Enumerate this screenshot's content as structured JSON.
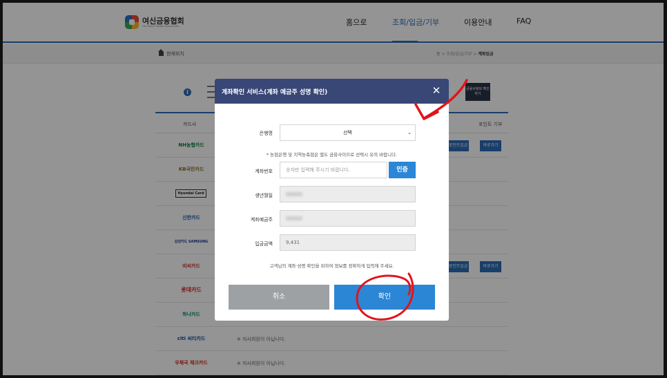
{
  "header": {
    "logo_title": "여신금융협회",
    "logo_sub": "THE CREDIT FINANCE ASSOCIATION",
    "nav": [
      "홈으로",
      "조회/입금/기부",
      "이용안내",
      "FAQ"
    ],
    "active_nav": "조회/입금/기부"
  },
  "breadcrumb": {
    "here": "현재위치",
    "trail": [
      "홈",
      "조회/입금/기부"
    ],
    "current": "계좌입금"
  },
  "background": {
    "dark_button": "금융사정보 확인하기",
    "table_headers": [
      "카드사",
      "포인트 기부"
    ],
    "cards": [
      "NH농협카드",
      "KB국민카드",
      "Hyundai Card",
      "신한카드",
      "삼성카드 SAMSUNG",
      "비씨카드",
      "롯데카드",
      "하나카드",
      "citi 씨티카드",
      "우체국 체크카드"
    ],
    "row_buttons": [
      "포인트입금",
      "바로가기"
    ],
    "non_member_note": "※ 자사회원이 아닙니다."
  },
  "modal": {
    "title": "계좌확인 서비스(계좌 예금주 성명 확인)",
    "bank_label": "은행명",
    "bank_value": "선택",
    "bank_note": "* 농협은행 및 지역농축협은 별도 금융사이므로 선택시 유의 바랍니다.",
    "account_label": "계좌번호",
    "account_placeholder": "숫자만 입력해 주시기 바랍니다.",
    "auth_button": "인증",
    "birth_label": "생년월일",
    "holder_label": "계좌예금주",
    "amount_label": "입금금액",
    "amount_value": "9,431",
    "footer_note": "고객님의 계좌·성명 확인을 위하여 정보를 정확하게 입력해 주세요.",
    "cancel_button": "취소",
    "confirm_button": "확인"
  },
  "colors": {
    "primary": "#2b6cb5",
    "modal_header": "#384776",
    "button_blue": "#2b86d6",
    "button_gray": "#9ea1a4",
    "annotation_red": "#e0141c"
  }
}
